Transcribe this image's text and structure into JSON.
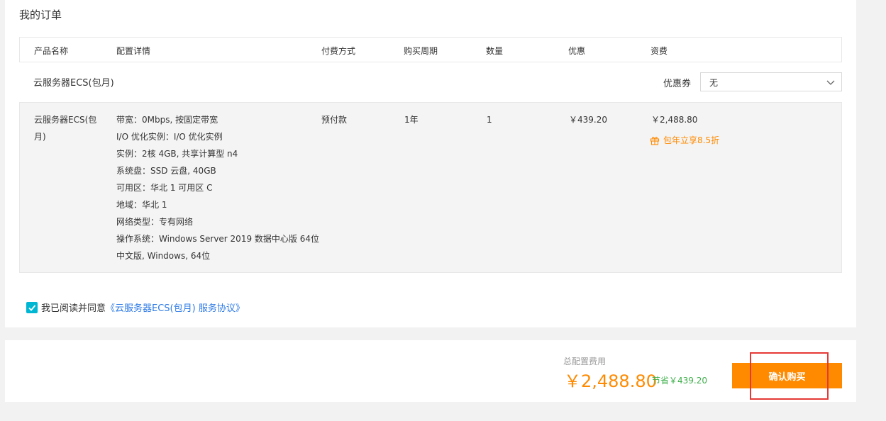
{
  "page": {
    "title": "我的订单"
  },
  "table": {
    "headers": [
      "产品名称",
      "配置详情",
      "付费方式",
      "购买周期",
      "数量",
      "优惠",
      "资费"
    ]
  },
  "product": {
    "name": "云服务器ECS(包月)",
    "coupon_label": "优惠券",
    "coupon_value": "无"
  },
  "order_item": {
    "name_line1": "云服务器ECS(包",
    "name_line2": "月)",
    "config": [
      "带宽：0Mbps, 按固定带宽",
      "I/O 优化实例：I/O 优化实例",
      "实例：2核 4GB, 共享计算型 n4",
      "系统盘：SSD 云盘, 40GB",
      "可用区：华北 1 可用区 C",
      "地域：华北 1",
      "网络类型：专有网络",
      "操作系统：Windows Server 2019 数据中心版 64位",
      "中文版, Windows, 64位"
    ],
    "payment": "预付款",
    "period": "1年",
    "quantity": "1",
    "discount": "￥439.20",
    "price": "￥2,488.80",
    "promo": "包年立享8.5折"
  },
  "agreement": {
    "text": "我已阅读并同意",
    "link": "《云服务器ECS(包月) 服务协议》",
    "checked": true
  },
  "summary": {
    "total_label": "总配置费用",
    "total_price": "￥2,488.80",
    "save_text": "节省￥439.20",
    "confirm_label": "确认购买"
  },
  "colors": {
    "accent_orange": "#ff8a00",
    "checkbox_teal": "#00b7d3",
    "link_blue": "#2e7be6",
    "save_green": "#3eaf4b",
    "highlight_red": "#e53935"
  }
}
